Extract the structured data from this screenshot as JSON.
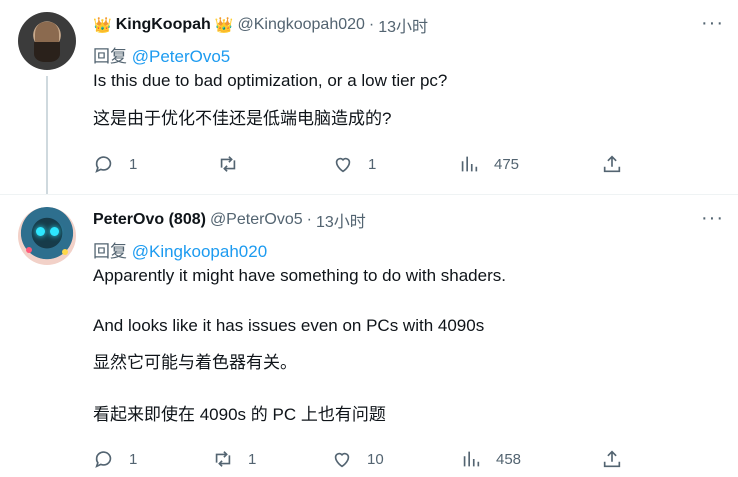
{
  "tweets": [
    {
      "name": "KingKoopah",
      "handle": "@Kingkoopah020",
      "time": "13小时",
      "reply_prefix": "回复",
      "reply_to": "@PeterOvo5",
      "lines": [
        "Is this due to bad optimization, or a low tier pc?",
        "这是由于优化不佳还是低端电脑造成的?"
      ],
      "actions": {
        "replies": "1",
        "retweets": "",
        "likes": "1",
        "views": "475"
      },
      "icons": [
        "crown-icon",
        "more-icon",
        "reply-icon",
        "retweet-icon",
        "like-icon",
        "views-icon",
        "share-icon"
      ]
    },
    {
      "name": "PeterOvo (808)",
      "handle": "@PeterOvo5",
      "time": "13小时",
      "reply_prefix": "回复",
      "reply_to": "@Kingkoopah020",
      "lines": [
        "Apparently it might have something to do with shaders.",
        "And looks like it has issues even on PCs with 4090s",
        "显然它可能与着色器有关。",
        "看起来即使在 4090s 的 PC 上也有问题"
      ],
      "actions": {
        "replies": "1",
        "retweets": "1",
        "likes": "10",
        "views": "458"
      },
      "icons": [
        "more-icon",
        "reply-icon",
        "retweet-icon",
        "like-icon",
        "views-icon",
        "share-icon"
      ]
    }
  ],
  "separator_dot": "·",
  "more_glyph": "···",
  "crown_glyph": "👑",
  "colors": {
    "link": "#1d9bf0",
    "secondary": "#536471",
    "text": "#0f1419"
  }
}
